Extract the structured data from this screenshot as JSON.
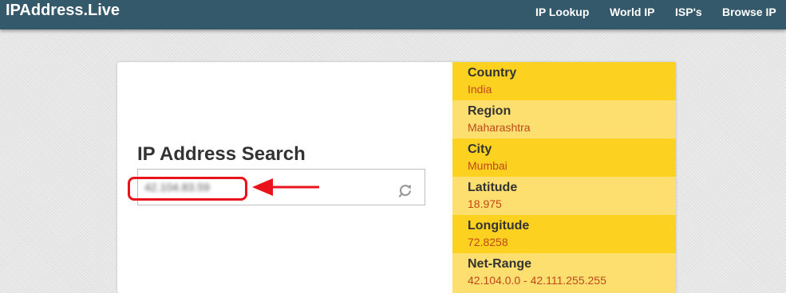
{
  "header": {
    "brand": "IPAddress.Live",
    "nav": [
      "IP Lookup",
      "World IP",
      "ISP's",
      "Browse IP"
    ]
  },
  "search": {
    "title": "IP Address Search",
    "value": "42.104.83.59"
  },
  "info": [
    {
      "label": "Country",
      "value": "India"
    },
    {
      "label": "Region",
      "value": "Maharashtra"
    },
    {
      "label": "City",
      "value": "Mumbai"
    },
    {
      "label": "Latitude",
      "value": "18.975"
    },
    {
      "label": "Longitude",
      "value": "72.8258"
    },
    {
      "label": "Net-Range",
      "value": "42.104.0.0 - 42.111.255.255"
    }
  ],
  "colors": {
    "navbar": "#34596a",
    "row_dark": "#fdd120",
    "row_light": "#fcdf6e",
    "value_text": "#c0481b",
    "annotation": "#e8131b"
  },
  "icons": {
    "search": "search-refresh-icon",
    "annotation": "arrow-left-icon"
  }
}
